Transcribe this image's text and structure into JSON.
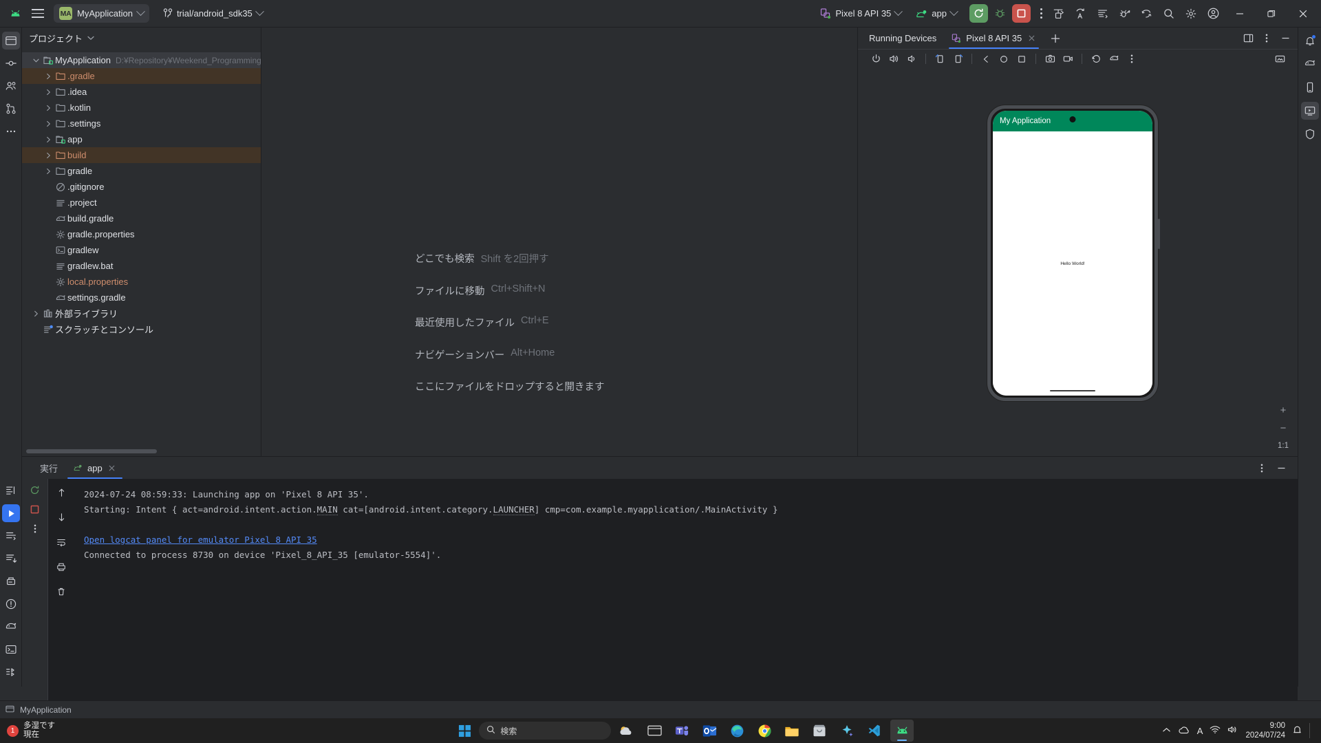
{
  "toolbar": {
    "android_logo": "android-logo",
    "menu_label": "main-menu",
    "project_badge": "MA",
    "project_name": "MyApplication",
    "branch_name": "trial/android_sdk35",
    "device_name": "Pixel 8 API 35",
    "run_config": "app",
    "run_tooltip": "Run",
    "debug_tooltip": "Debug",
    "stop_tooltip": "Stop",
    "more_tooltip": "More"
  },
  "project_panel": {
    "title": "プロジェクト",
    "tree": [
      {
        "label": "MyApplication",
        "path": "D:¥Repository¥Weekend_Programming",
        "depth": 0,
        "arrow": "open",
        "icon": "module-folder-icon",
        "state": "sel-grey"
      },
      {
        "label": ".gradle",
        "depth": 1,
        "arrow": "closed",
        "icon": "excluded-folder-icon",
        "state": "sel-brown",
        "color": "orange"
      },
      {
        "label": ".idea",
        "depth": 1,
        "arrow": "closed",
        "icon": "folder-icon"
      },
      {
        "label": ".kotlin",
        "depth": 1,
        "arrow": "closed",
        "icon": "folder-icon"
      },
      {
        "label": ".settings",
        "depth": 1,
        "arrow": "closed",
        "icon": "folder-icon"
      },
      {
        "label": "app",
        "depth": 1,
        "arrow": "closed",
        "icon": "module-folder-icon"
      },
      {
        "label": "build",
        "depth": 1,
        "arrow": "closed",
        "icon": "excluded-folder-icon",
        "state": "sel-brown",
        "color": "orange"
      },
      {
        "label": "gradle",
        "depth": 1,
        "arrow": "closed",
        "icon": "folder-icon"
      },
      {
        "label": ".gitignore",
        "depth": 1,
        "arrow": "none",
        "icon": "gitignore-icon"
      },
      {
        "label": ".project",
        "depth": 1,
        "arrow": "none",
        "icon": "text-file-icon"
      },
      {
        "label": "build.gradle",
        "depth": 1,
        "arrow": "none",
        "icon": "gradle-file-icon"
      },
      {
        "label": "gradle.properties",
        "depth": 1,
        "arrow": "none",
        "icon": "properties-file-icon"
      },
      {
        "label": "gradlew",
        "depth": 1,
        "arrow": "none",
        "icon": "shell-script-icon"
      },
      {
        "label": "gradlew.bat",
        "depth": 1,
        "arrow": "none",
        "icon": "text-file-icon"
      },
      {
        "label": "local.properties",
        "depth": 1,
        "arrow": "none",
        "icon": "properties-file-icon",
        "color": "orange"
      },
      {
        "label": "settings.gradle",
        "depth": 1,
        "arrow": "none",
        "icon": "gradle-file-icon"
      },
      {
        "label": "外部ライブラリ",
        "depth": 0,
        "arrow": "closed",
        "icon": "library-icon"
      },
      {
        "label": "スクラッチとコンソール",
        "depth": 0,
        "arrow": "none",
        "icon": "scratches-icon"
      }
    ]
  },
  "editor": {
    "hints": [
      {
        "label": "どこでも検索",
        "key": "Shift を2回押す"
      },
      {
        "label": "ファイルに移動",
        "key": "Ctrl+Shift+N"
      },
      {
        "label": "最近使用したファイル",
        "key": "Ctrl+E"
      },
      {
        "label": "ナビゲーションバー",
        "key": "Alt+Home"
      },
      {
        "label": "ここにファイルをドロップすると開きます",
        "key": ""
      }
    ]
  },
  "devices_panel": {
    "title": "Running Devices",
    "tab_label": "Pixel 8 API 35",
    "new_tab_tooltip": "New Tab",
    "toolbar_icons": [
      "power-icon",
      "volume-up-icon",
      "volume-down-icon",
      "rotate-left-icon",
      "rotate-right-icon",
      "back-icon",
      "home-icon",
      "overview-icon",
      "screenshot-icon",
      "record-screen-icon",
      "undo-icon",
      "device-settings-icon",
      "more-icon"
    ],
    "emulator": {
      "app_title": "My Application",
      "content_text": "Hello World!"
    },
    "zoom": {
      "in": "+",
      "out": "−",
      "ratio": "1:1"
    }
  },
  "run_panel": {
    "tabs": [
      {
        "label": "実行",
        "active": false,
        "icon": ""
      },
      {
        "label": "app",
        "active": true,
        "icon": "android-run-icon"
      }
    ],
    "console": {
      "line1": "2024-07-24 08:59:33: Launching app on 'Pixel 8 API 35'.",
      "line2_a": "Starting: Intent { act=android.intent.action.",
      "line2_b": "MAIN",
      "line2_c": " cat=[android.intent.category.",
      "line2_d": "LAUNCHER",
      "line2_e": "] cmp=com.example.myapplication/.MainActivity }",
      "link": "Open logcat panel for emulator Pixel 8 API 35",
      "line4": "Connected to process 8730 on device 'Pixel_8_API_35 [emulator-5554]'."
    }
  },
  "status_bar": {
    "text": "MyApplication"
  },
  "taskbar": {
    "notice_count": "1",
    "notice_line1": "多湿です",
    "notice_line2": "現在",
    "search_placeholder": "検索",
    "clock_time": "9:00",
    "clock_date": "2024/07/24",
    "apps": [
      "widgets-icon",
      "search-icon",
      "weather-icon",
      "taskview-icon",
      "teams-icon",
      "outlook-icon",
      "edge-icon",
      "chrome-icon",
      "explorer-icon",
      "store-icon",
      "copilot-icon",
      "vscode-icon",
      "android-studio-icon"
    ],
    "tray": [
      "chevron-up-icon",
      "onedrive-icon",
      "ime-icon",
      "wifi-icon",
      "speaker-icon"
    ]
  },
  "colors": {
    "accent_blue": "#3574f0",
    "run_green": "#5d9c63",
    "stop_red": "#c9534c",
    "excluded_orange": "#cf8e6d",
    "app_bar_green": "#00875a",
    "bg": "#2b2d30",
    "console_bg": "#1e1f22"
  }
}
